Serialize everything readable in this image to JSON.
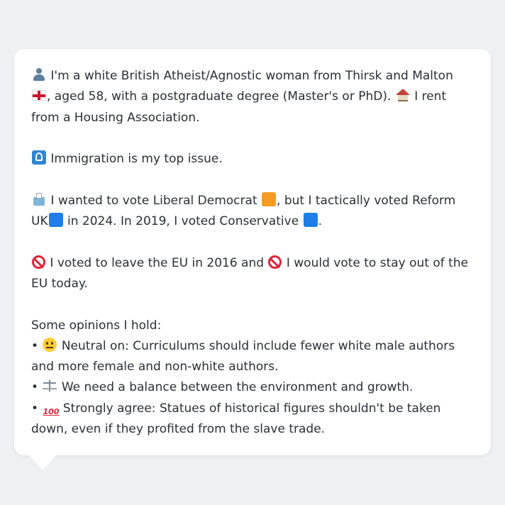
{
  "profile": {
    "identity_pre": "I'm a white British Atheist/Agnostic woman from Thirsk and Malton",
    "identity_post": ", aged 58, with a postgraduate degree (Master's or PhD).",
    "housing": "I rent from a Housing Association.",
    "top_issue": "Immigration is my top issue.",
    "vote_a": "I wanted to vote Liberal Democrat",
    "vote_b": ", but I tactically voted Reform UK",
    "vote_c": "in 2024. In 2019, I voted Conservative",
    "vote_d": ".",
    "eu_a": "I voted to leave the EU in 2016 and",
    "eu_b": "I would vote to stay out of the EU today.",
    "opinions_heading": "Some opinions I hold:",
    "bullet": "•",
    "opinion_1": "Neutral on: Curriculums should include fewer white male authors and more female and non-white authors.",
    "opinion_2": "We need a balance between the environment and growth.",
    "opinion_3": "Strongly agree: Statues of historical figures shouldn't be taken down, even if they profited from the slave trade.",
    "hundred_text": "100"
  },
  "icons": {
    "person": "person-icon",
    "flag": "england-flag-icon",
    "house": "house-icon",
    "immigration": "immigration-icon",
    "ballot": "ballot-box-icon",
    "libdem": "orange-square-icon",
    "reform": "blue-square-icon",
    "conservative": "blue-square-icon",
    "no_entry": "no-entry-icon",
    "neutral": "neutral-face-icon",
    "scales": "balance-scale-icon",
    "hundred": "hundred-points-icon"
  },
  "colors": {
    "background": "#eef0f3",
    "card": "#ffffff",
    "text": "#2b2f36",
    "libdem_orange": "#f59a23",
    "party_blue": "#1e7de6"
  }
}
